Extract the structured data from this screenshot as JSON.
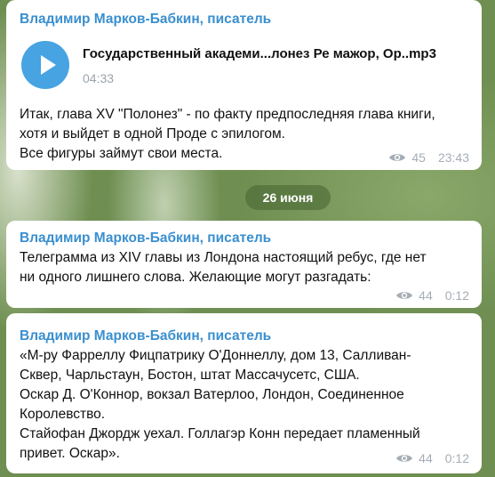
{
  "messages": [
    {
      "sender": "Владимир Марков-Бабкин, писатель",
      "audio": {
        "title": "Государственный академи...лонез Ре мажор, Ор..mp3",
        "duration": "04:33"
      },
      "lines": [
        "Итак, глава XV \"Полонез\" - по факту предпоследняя глава книги,",
        "хотя и выйдет в одной Проде с эпилогом.",
        "Все фигуры займут свои места."
      ],
      "views": "45",
      "time": "23:43"
    },
    {
      "sender": "Владимир Марков-Бабкин, писатель",
      "lines": [
        "Телеграмма из XIV главы из Лондона настоящий ребус, где нет",
        "ни одного лишнего слова. Желающие могут разгадать:"
      ],
      "views": "44",
      "time": "0:12"
    },
    {
      "sender": "Владимир Марков-Бабкин, писатель",
      "lines": [
        "«М-ру Фарреллу Фицпатрику О'Доннеллу, дом 13, Салливан-",
        "Сквер, Чарльстаун, Бостон, штат Массачусетс, США.",
        "Оскар Д. О'Коннор, вокзал Ватерлоо, Лондон, Соединенное",
        "Королевство.",
        "Стайофан Джордж уехал. Голлагэр Конн передает пламенный",
        "привет. Оскар»."
      ],
      "views": "44",
      "time": "0:12"
    }
  ],
  "date_separator": "26 июня",
  "colors": {
    "accent": "#3a8fcf",
    "play_button": "#47a3e2",
    "meta": "#a5adb6"
  },
  "icons": {
    "play": "play-icon",
    "views": "eye-icon"
  }
}
